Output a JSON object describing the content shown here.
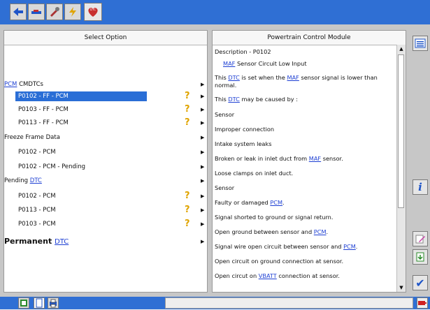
{
  "colors": {
    "accent": "#2f6fd4",
    "selection": "#2a6ed6",
    "link": "#1d3fd3",
    "help": "#e0a400"
  },
  "toolbar": {
    "icons": [
      "back-arrow-icon",
      "vehicle-icon",
      "tools-icon",
      "flash-icon",
      "dtc-icon"
    ],
    "dtc_label": "DTC"
  },
  "left_panel": {
    "title": "Select Option",
    "pcm_link": "PCM",
    "pcm_rest": " CMDTCs",
    "cmdtcs": [
      "P0102 - FF - PCM",
      "P0103 - FF - PCM",
      "P0113 - FF - PCM"
    ],
    "freeze_header": "Freeze Frame Data",
    "freeze": [
      "P0102 - PCM",
      "P0102 - PCM - Pending"
    ],
    "pending_prefix": "Pending ",
    "pending_link": "DTC",
    "pending": [
      "P0102 - PCM",
      "P0113 - PCM",
      "P0103 - PCM"
    ],
    "permanent_prefix": "Permanent ",
    "permanent_link": "DTC",
    "help_glyph": "?",
    "arrow_glyph": "▶"
  },
  "right_panel": {
    "title": "Powertrain Control Module",
    "description": "Description - P0102",
    "summary_link": "MAF",
    "summary_rest": " Sensor Circuit Low Input",
    "set_a": "This ",
    "set_dtc": "DTC",
    "set_b": " is set when the ",
    "set_maf": "MAF",
    "set_c": " sensor signal is lower than normal.",
    "cause_a": "This ",
    "cause_dtc": "DTC",
    "cause_b": " may be caused by :",
    "l_sensor1": "Sensor",
    "l_improper": "Improper connection",
    "l_intake": "Intake system leaks",
    "l_broken_a": "Broken or leak in inlet duct from ",
    "l_broken_maf": "MAF",
    "l_broken_b": " sensor.",
    "l_loose": "Loose clamps on inlet duct.",
    "l_sensor2": "Sensor",
    "l_faulty_a": "Faulty or damaged ",
    "l_faulty_pcm": "PCM",
    "l_faulty_b": ".",
    "l_shorted": "Signal shorted to ground or signal return.",
    "l_openground_a": "Open ground between sensor and ",
    "l_openground_pcm": "PCM",
    "l_openground_b": ".",
    "l_wire_a": "Signal wire open circuit between sensor and ",
    "l_wire_pcm": "PCM",
    "l_wire_b": ".",
    "l_opencirc": "Open circuit on ground connection at sensor.",
    "l_vbatt_a": "Open circut on ",
    "l_vbatt_link": "VBATT",
    "l_vbatt_b": " connection at sensor."
  },
  "sidebar": {
    "icons": [
      "list-icon",
      "info-icon",
      "edit-icon",
      "export-icon",
      "checkmark-icon"
    ],
    "info_glyph": "i",
    "check_glyph": "✔"
  },
  "bottombar": {
    "icons": [
      "screenshot-icon",
      "document-icon",
      "print-icon",
      "battery-icon"
    ]
  }
}
